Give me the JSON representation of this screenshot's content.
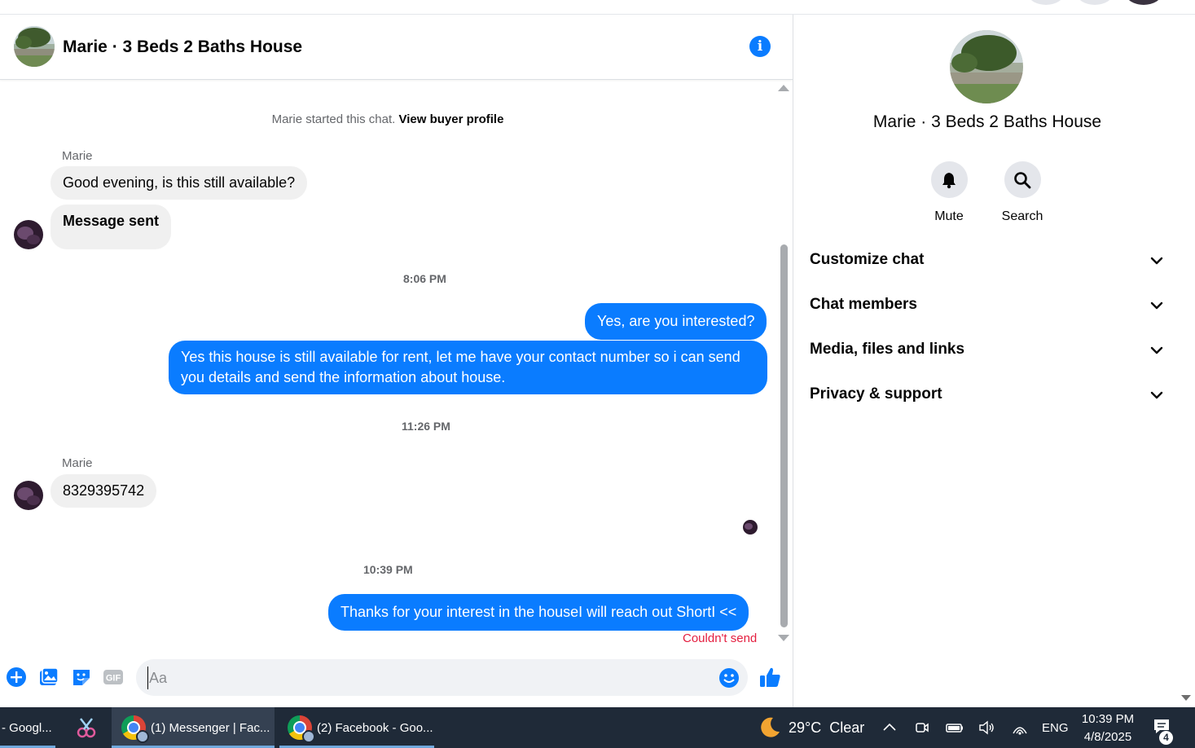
{
  "chat": {
    "title": "Marie · 3 Beds 2 Baths House",
    "started_text": "Marie started this chat.",
    "view_profile_link": "View buyer profile",
    "messages_group1": {
      "sender": "Marie",
      "msg1": "Good evening, is this still available?",
      "msg2": "Message sent"
    },
    "time1": "8:06 PM",
    "out1": "Yes, are you interested?",
    "out2": "Yes this house is still available for rent, let me have your contact number so i can send you details and send the information about house.",
    "time2": "11:26 PM",
    "messages_group2": {
      "sender": "Marie",
      "msg1": "8329395742"
    },
    "time3": "10:39 PM",
    "out3": "Thanks for your interest in the houseI will reach out ShortI <<",
    "error_text": "Couldn't send",
    "composer_placeholder": "Aa"
  },
  "details": {
    "title": "Marie · 3 Beds 2 Baths House",
    "actions": [
      {
        "label": "Mute",
        "icon": "bell-icon"
      },
      {
        "label": "Search",
        "icon": "search-icon"
      }
    ],
    "sections": [
      {
        "label": "Customize chat"
      },
      {
        "label": "Chat members"
      },
      {
        "label": "Media, files and links"
      },
      {
        "label": "Privacy & support"
      }
    ]
  },
  "taskbar": {
    "item0": "- Googl...",
    "item2": "(1) Messenger | Fac...",
    "item3": "(2) Facebook - Goo...",
    "weather": "29°C  Clear",
    "language": "ENG",
    "time": "10:39 PM",
    "date": "4/8/2025",
    "notification_count": "4"
  },
  "colors": {
    "messenger_blue": "#0a7cff",
    "incoming_bubble": "#f0f0f0",
    "error_red": "#e41e3f",
    "taskbar": "#1f2a38"
  }
}
